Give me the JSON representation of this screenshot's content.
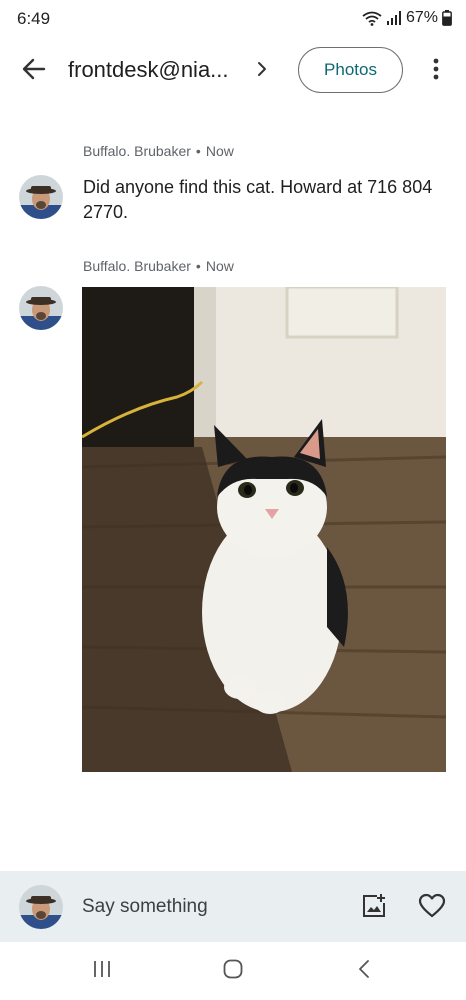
{
  "status": {
    "time": "6:49",
    "battery": "67%",
    "icons": [
      "wifi-icon",
      "signal-icon",
      "battery-icon"
    ]
  },
  "app_bar": {
    "title": "frontdesk@nia...",
    "photos_label": "Photos",
    "icons": [
      "back-arrow-icon",
      "chevron-right-icon",
      "more-vert-icon"
    ]
  },
  "messages": [
    {
      "author": "Buffalo. Brubaker",
      "time": "Now",
      "separator": "•",
      "text": "Did anyone find this cat. Howard at 716 804 2770."
    },
    {
      "author": "Buffalo. Brubaker",
      "time": "Now",
      "separator": "•",
      "image": "photo of a black-and-white cat sitting on a wooden floor"
    }
  ],
  "compose": {
    "placeholder": "Say something",
    "icons": [
      "add-photo-icon",
      "heart-icon"
    ]
  },
  "nav": {
    "icons": [
      "recent-apps-icon",
      "home-icon",
      "back-icon"
    ]
  },
  "colors": {
    "accent": "#0b6a73",
    "compose_bg": "#e9eef0",
    "meta_text": "#5f6368"
  }
}
